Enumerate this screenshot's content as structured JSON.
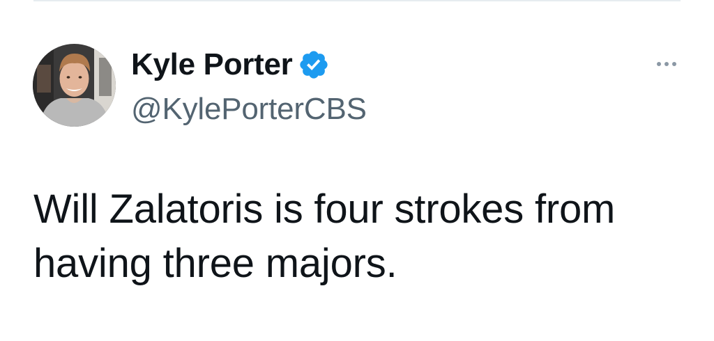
{
  "author": {
    "display_name": "Kyle Porter",
    "handle": "@KylePorterCBS",
    "verified": true,
    "avatar_icon": "profile-photo"
  },
  "tweet": {
    "text": "Will Zalatoris is four strokes from having three majors."
  },
  "actions": {
    "more_icon": "more-horizontal-icon"
  },
  "colors": {
    "text_primary": "#0f1419",
    "text_secondary": "#536471",
    "verified_blue": "#1d9bf0",
    "divider": "#e6ecf0",
    "more_dots": "#8b98a5"
  }
}
